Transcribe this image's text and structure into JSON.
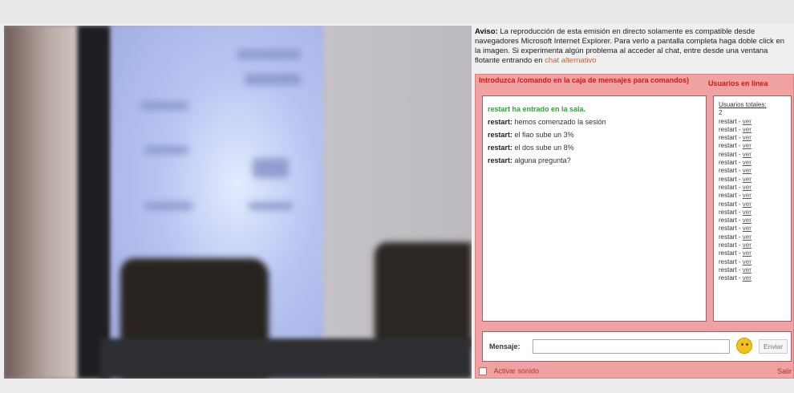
{
  "notice": {
    "label": "Aviso:",
    "text": "La reproducción de esta emisión en directo solamente es compatible desde navegadores Microsoft Internet Explorer. Para verlo a pantalla completa haga doble click en la imagen. Si experimenta algún problema al acceder al chat, entre desde una ventana flotante entrando en",
    "link": "chat alternativo"
  },
  "chat": {
    "header_left": "Introduzca /comando en la caja de mensajes para comandos)",
    "header_right": "Usuarios en línea",
    "messages": [
      {
        "user": "",
        "text": "restart ha entrado en la sala.",
        "type": "joined"
      },
      {
        "user": "restart:",
        "text": "hemos comenzado la sesión",
        "type": "msg"
      },
      {
        "user": "restart:",
        "text": "el fiao sube un 3%",
        "type": "msg"
      },
      {
        "user": "restart:",
        "text": "el dos sube un 8%",
        "type": "msg"
      },
      {
        "user": "restart:",
        "text": "alguna pregunta?",
        "type": "msg"
      }
    ],
    "users_title": "Usuarios totales:",
    "users_count": "2",
    "users": [
      {
        "name": "restart",
        "link": "ver"
      },
      {
        "name": "restart",
        "link": "ver"
      },
      {
        "name": "restart",
        "link": "ver"
      },
      {
        "name": "restart",
        "link": "ver"
      },
      {
        "name": "restart",
        "link": "ver"
      },
      {
        "name": "restart",
        "link": "ver"
      },
      {
        "name": "restart",
        "link": "ver"
      },
      {
        "name": "restart",
        "link": "ver"
      },
      {
        "name": "restart",
        "link": "ver"
      },
      {
        "name": "restart",
        "link": "ver"
      },
      {
        "name": "restart",
        "link": "ver"
      },
      {
        "name": "restart",
        "link": "ver"
      },
      {
        "name": "restart",
        "link": "ver"
      },
      {
        "name": "restart",
        "link": "ver"
      },
      {
        "name": "restart",
        "link": "ver"
      },
      {
        "name": "restart",
        "link": "ver"
      },
      {
        "name": "restart",
        "link": "ver"
      },
      {
        "name": "restart",
        "link": "ver"
      },
      {
        "name": "restart",
        "link": "ver"
      },
      {
        "name": "restart",
        "link": "ver"
      }
    ],
    "message_label": "Mensaje:",
    "message_value": "",
    "send_label": "Enviar",
    "sound_label": "Activar sonido",
    "corner_link": "Salir"
  },
  "colors": {
    "panel": "#f0a2a2",
    "header_text": "#c02020",
    "joined": "#3b9b3b"
  },
  "icons": {
    "emoticon": "smiley-icon"
  }
}
